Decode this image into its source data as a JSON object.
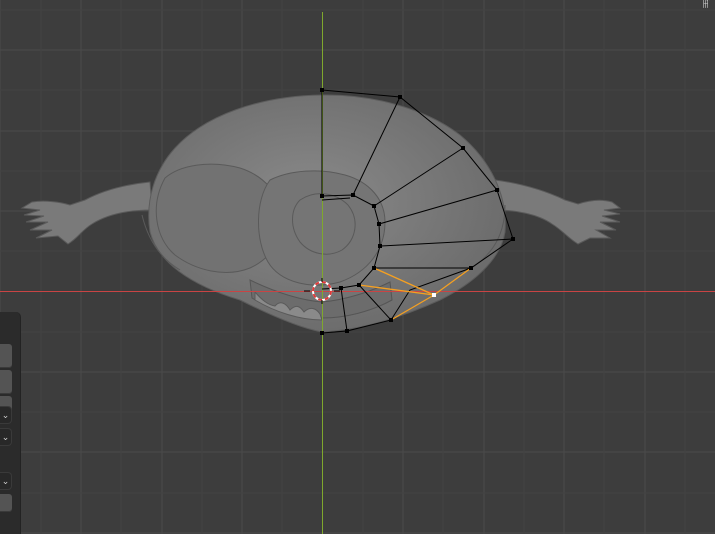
{
  "app": "3D Viewport",
  "colors": {
    "background": "#3d3d3d",
    "grid": "#4a4a4a",
    "y_axis": "#7fa82d",
    "x_axis": "#c94444",
    "mesh_surface": "#6e6e6e",
    "edge_selected": "#f5a021",
    "edge": "#000000",
    "vertex": "#000000",
    "cursor_ring": "#e03a3a"
  },
  "icons": {
    "corner": "gizmo-toggle-icon",
    "dropdown": "chevron-down-icon"
  },
  "corner_glyph": "ꂵ",
  "dropdown_glyph": "⌄"
}
